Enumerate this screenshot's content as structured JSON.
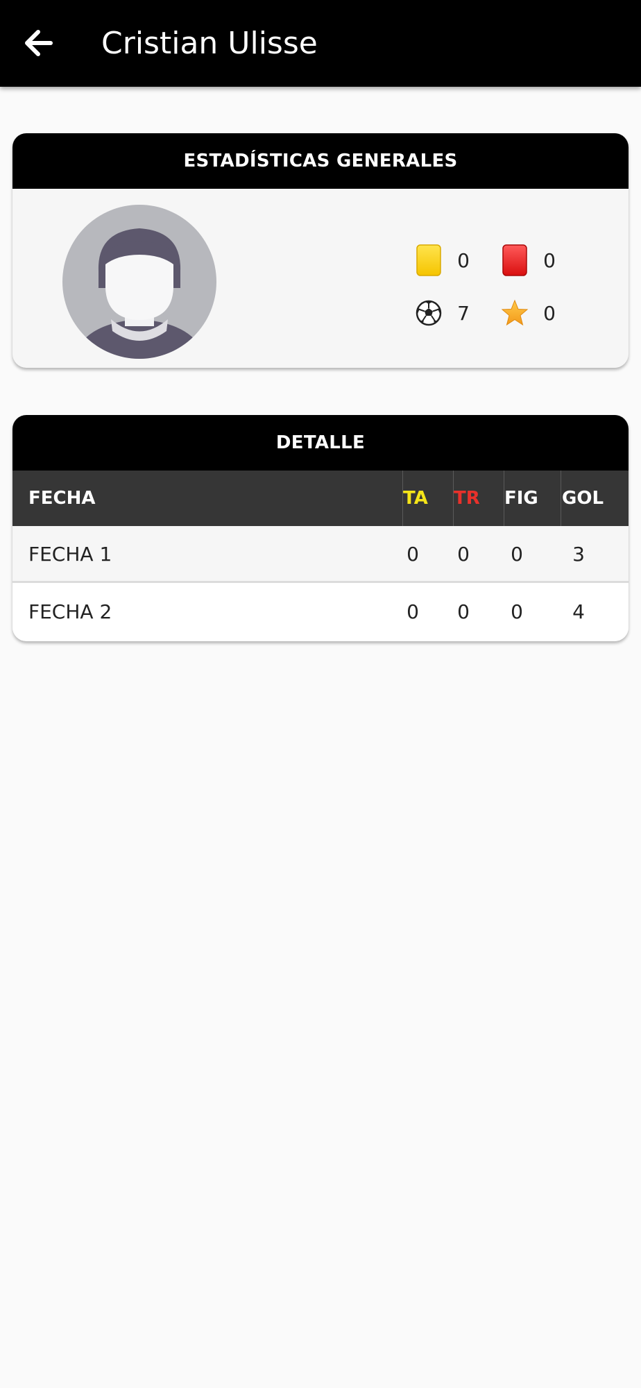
{
  "header": {
    "title": "Cristian Ulisse"
  },
  "general": {
    "title": "ESTADÍSTICAS GENERALES",
    "stats": {
      "yellow_cards": "0",
      "red_cards": "0",
      "goals": "7",
      "mvp": "0"
    },
    "icons": [
      "yellow-card-icon",
      "red-card-icon",
      "soccer-ball-icon",
      "star-icon"
    ],
    "colors": {
      "yellow_card": "#ffd81f",
      "red_card": "#ee1c1c",
      "star": "#f6a623"
    }
  },
  "detail": {
    "title": "DETALLE",
    "columns": {
      "fecha": "FECHA",
      "ta": "TA",
      "tr": "TR",
      "fig": "FIG",
      "gol": "GOL"
    },
    "column_colors": {
      "ta": "#f5e519",
      "tr": "#e8312b"
    },
    "rows": [
      {
        "fecha": "FECHA 1",
        "ta": "0",
        "tr": "0",
        "fig": "0",
        "gol": "3"
      },
      {
        "fecha": "FECHA 2",
        "ta": "0",
        "tr": "0",
        "fig": "0",
        "gol": "4"
      }
    ]
  }
}
